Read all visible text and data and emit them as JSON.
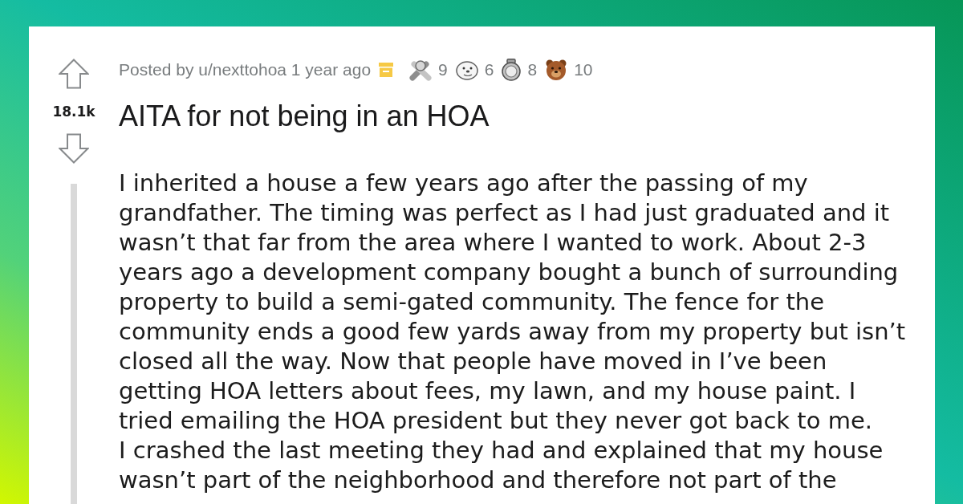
{
  "vote": {
    "score": "18.1k"
  },
  "post": {
    "byline": "Posted by u/nexttohoa 1 year ago",
    "archived": true,
    "awards": [
      {
        "kind": "hands",
        "count": "9"
      },
      {
        "kind": "seal",
        "count": "6"
      },
      {
        "kind": "coin",
        "count": "8"
      },
      {
        "kind": "bear",
        "count": "10"
      }
    ],
    "title": "AITA for not being in an HOA",
    "body": [
      "I inherited a house a few years ago after the passing of my grandfather. The timing was perfect as I had just graduated and it wasn’t that far from the area where I wanted to work. About 2-3 years ago a development company bought a bunch of surrounding property to build a semi-gated community. The fence for the community ends a good few yards away from my property but isn’t closed all the way. Now that people have moved in I’ve been getting HOA letters about fees, my lawn, and my house paint. I tried emailing the HOA president but they never got back to me.",
      "I crashed the last meeting they had and explained that my house wasn’t part of the neighborhood and therefore not part of the"
    ]
  }
}
